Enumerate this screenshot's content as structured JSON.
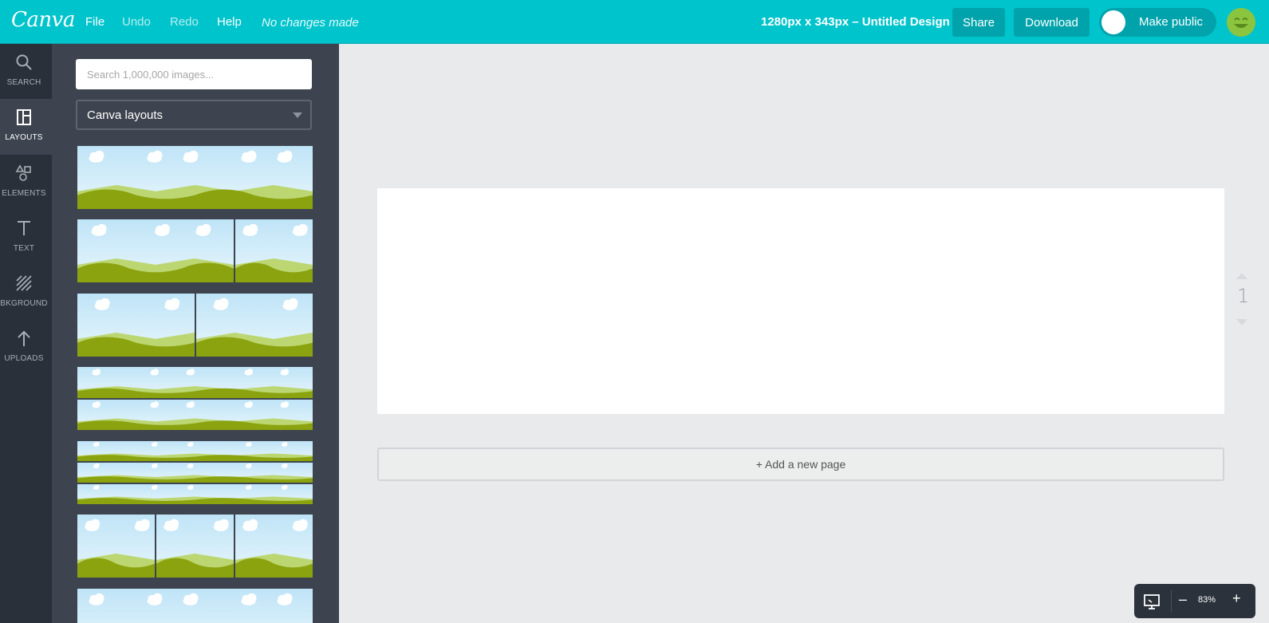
{
  "topbar": {
    "logo": "Canva",
    "menu": {
      "file": "File",
      "undo": "Undo",
      "redo": "Redo",
      "help": "Help"
    },
    "status": "No changes made",
    "design_title": "1280px x 343px – Untitled Design",
    "share_label": "Share",
    "download_label": "Download",
    "public_label": "Make public"
  },
  "sidebar": {
    "items": [
      {
        "label": "SEARCH",
        "icon": "search-icon"
      },
      {
        "label": "LAYOUTS",
        "icon": "layouts-icon"
      },
      {
        "label": "ELEMENTS",
        "icon": "elements-icon"
      },
      {
        "label": "TEXT",
        "icon": "text-icon"
      },
      {
        "label": "BKGROUND",
        "icon": "background-icon"
      },
      {
        "label": "UPLOADS",
        "icon": "uploads-icon"
      }
    ],
    "active": "LAYOUTS"
  },
  "panel": {
    "search_placeholder": "Search 1,000,000 images...",
    "dropdown_value": "Canva layouts",
    "thumbnails": [
      {
        "kind": "single"
      },
      {
        "kind": "two-split-wide"
      },
      {
        "kind": "two-split-even"
      },
      {
        "kind": "two-rows"
      },
      {
        "kind": "three-rows"
      },
      {
        "kind": "three-columns"
      },
      {
        "kind": "single-partial"
      }
    ]
  },
  "canvas": {
    "add_page_label": "+ Add a new page",
    "page_number": "1"
  },
  "zoom": {
    "minus": "–",
    "value": "83%",
    "plus": "+"
  },
  "colors": {
    "brand": "#00c4cc",
    "button": "#00a3ab",
    "nav_bg": "#293039",
    "panel_bg": "#3e444f",
    "canvas_bg": "#e9eaec"
  }
}
